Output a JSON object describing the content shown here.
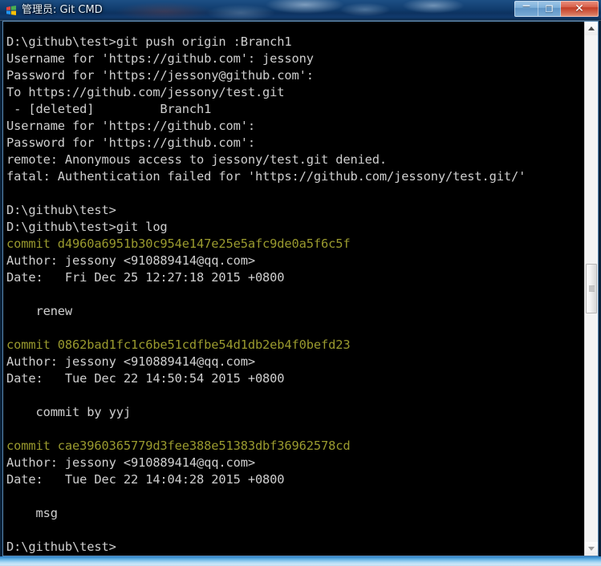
{
  "window": {
    "title": "管理员: Git CMD",
    "icon": "git-cmd-icon",
    "buttons": {
      "minimize": "─",
      "maximize": "❐",
      "close": "✕"
    }
  },
  "scrollbar": {
    "up_arrow": "▲",
    "down_arrow": "▼"
  },
  "console": {
    "lines": [
      {
        "text": "D:\\github\\test>git push origin :Branch1",
        "style": "normal"
      },
      {
        "text": "Username for 'https://github.com': jessony",
        "style": "normal"
      },
      {
        "text": "Password for 'https://jessony@github.com':",
        "style": "normal"
      },
      {
        "text": "To https://github.com/jessony/test.git",
        "style": "normal"
      },
      {
        "text": " - [deleted]         Branch1",
        "style": "normal"
      },
      {
        "text": "Username for 'https://github.com':",
        "style": "normal"
      },
      {
        "text": "Password for 'https://github.com':",
        "style": "normal"
      },
      {
        "text": "remote: Anonymous access to jessony/test.git denied.",
        "style": "normal"
      },
      {
        "text": "fatal: Authentication failed for 'https://github.com/jessony/test.git/'",
        "style": "normal"
      },
      {
        "text": "",
        "style": "blank"
      },
      {
        "text": "D:\\github\\test>",
        "style": "normal"
      },
      {
        "text": "D:\\github\\test>git log",
        "style": "normal"
      },
      {
        "text": "commit d4960a6951b30c954e147e25e5afc9de0a5f6c5f",
        "style": "hash"
      },
      {
        "text": "Author: jessony <910889414@qq.com>",
        "style": "normal"
      },
      {
        "text": "Date:   Fri Dec 25 12:27:18 2015 +0800",
        "style": "normal"
      },
      {
        "text": "",
        "style": "blank"
      },
      {
        "text": "    renew",
        "style": "normal"
      },
      {
        "text": "",
        "style": "blank"
      },
      {
        "text": "commit 0862bad1fc1c6be51cdfbe54d1db2eb4f0befd23",
        "style": "hash"
      },
      {
        "text": "Author: jessony <910889414@qq.com>",
        "style": "normal"
      },
      {
        "text": "Date:   Tue Dec 22 14:50:54 2015 +0800",
        "style": "normal"
      },
      {
        "text": "",
        "style": "blank"
      },
      {
        "text": "    commit by yyj",
        "style": "normal"
      },
      {
        "text": "",
        "style": "blank"
      },
      {
        "text": "commit cae3960365779d3fee388e51383dbf36962578cd",
        "style": "hash"
      },
      {
        "text": "Author: jessony <910889414@qq.com>",
        "style": "normal"
      },
      {
        "text": "Date:   Tue Dec 22 14:04:28 2015 +0800",
        "style": "normal"
      },
      {
        "text": "",
        "style": "blank"
      },
      {
        "text": "    msg",
        "style": "normal"
      },
      {
        "text": "",
        "style": "blank"
      },
      {
        "text": "D:\\github\\test>",
        "style": "normal"
      }
    ]
  },
  "colors": {
    "console_background": "#000000",
    "console_text": "#cfcfcf",
    "commit_hash": "#9a9a2e",
    "titlebar_blue": "#103c6d",
    "close_button_red": "#c23d26"
  }
}
